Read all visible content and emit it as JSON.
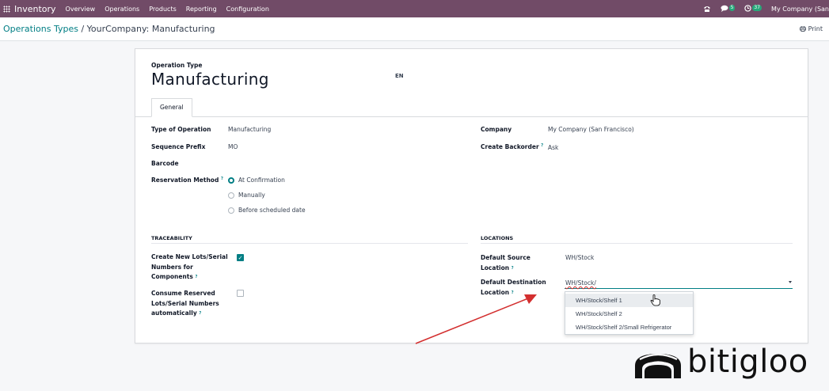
{
  "topbar": {
    "app_name": "Inventory",
    "menu": [
      "Overview",
      "Operations",
      "Products",
      "Reporting",
      "Configuration"
    ],
    "messages_count": "5",
    "activities_count": "37",
    "company": "My Company (San"
  },
  "control_panel": {
    "breadcrumb_parent": "Operations Types",
    "breadcrumb_sep": " / ",
    "breadcrumb_current": "YourCompany: Manufacturing",
    "print_label": "Print"
  },
  "form": {
    "operation_type_label": "Operation Type",
    "name": "Manufacturing",
    "lang": "EN",
    "tab_general": "General",
    "type_of_operation_label": "Type of Operation",
    "type_of_operation_value": "Manufacturing",
    "sequence_prefix_label": "Sequence Prefix",
    "sequence_prefix_value": "MO",
    "barcode_label": "Barcode",
    "reservation_label": "Reservation Method",
    "reservation_options": [
      "At Confirmation",
      "Manually",
      "Before scheduled date"
    ],
    "reservation_selected": "At Confirmation",
    "company_label": "Company",
    "company_value": "My Company (San Francisco)",
    "backorder_label": "Create Backorder",
    "backorder_value": "Ask",
    "traceability_title": "TRACEABILITY",
    "create_lots_label_1": "Create New Lots/Serial",
    "create_lots_label_2": "Numbers for",
    "create_lots_label_3": "Components",
    "create_lots_checked": true,
    "consume_label_1": "Consume Reserved",
    "consume_label_2": "Lots/Serial Numbers",
    "consume_label_3": "automatically",
    "consume_checked": false,
    "locations_title": "LOCATIONS",
    "src_label_1": "Default Source",
    "src_label_2": "Location",
    "src_value": "WH/Stock",
    "dest_label_1": "Default Destination",
    "dest_label_2": "Location",
    "dest_value": "WH/Stock/",
    "help_mark": "?"
  },
  "autocomplete": [
    "WH/Stock/Shelf 1",
    "WH/Stock/Shelf 2",
    "WH/Stock/Shelf 2/Small Refrigerator"
  ],
  "watermark": "bitigloo",
  "colors": {
    "brand": "#714b67",
    "accent": "#017e84",
    "arrow": "#d32f2f"
  }
}
